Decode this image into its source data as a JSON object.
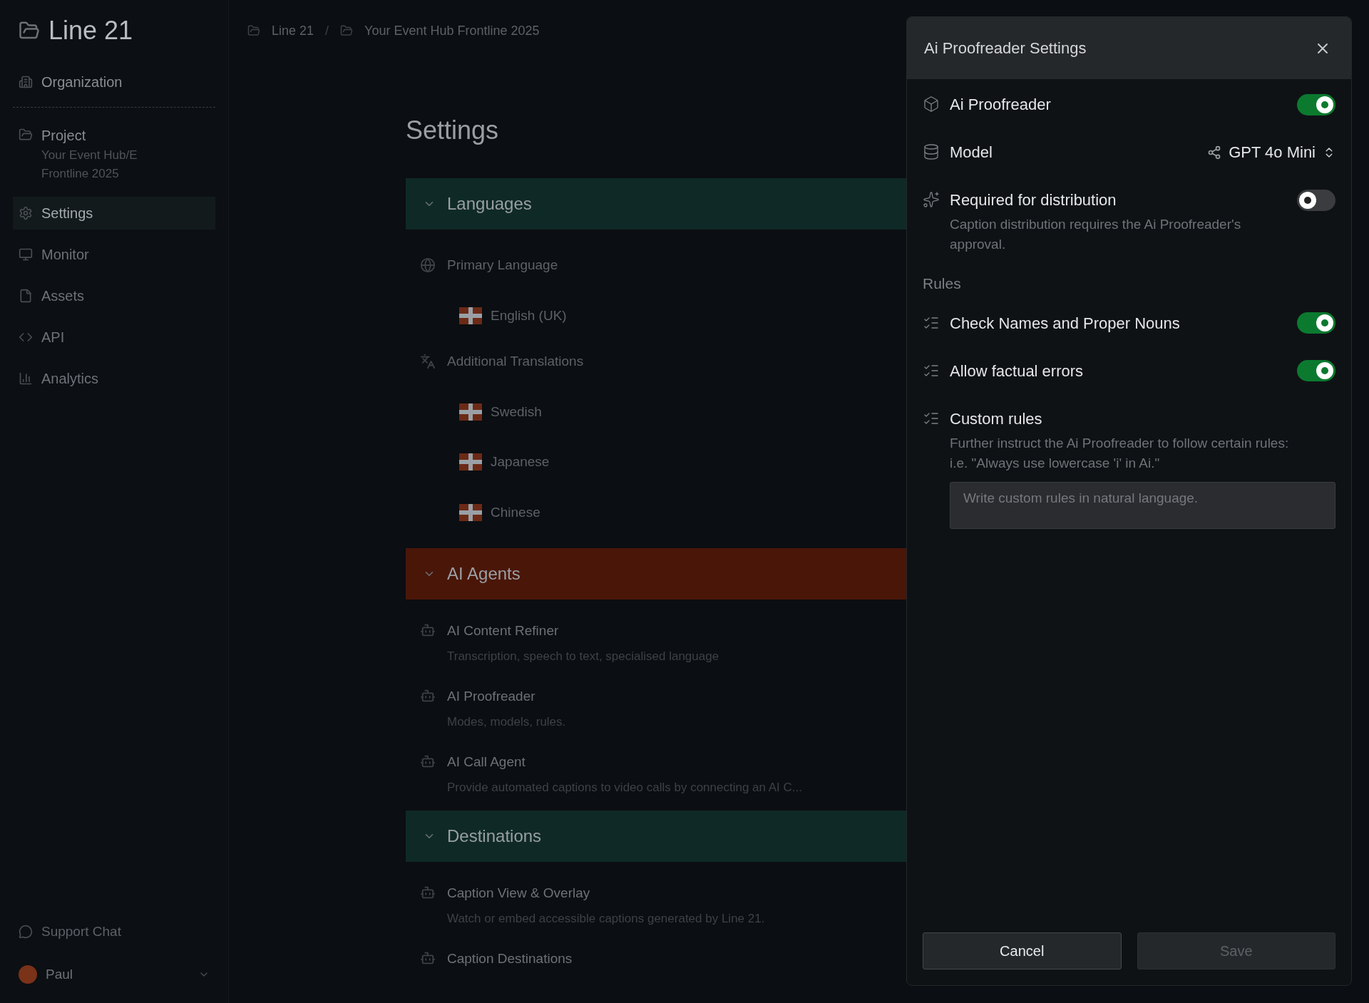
{
  "sidebar": {
    "logo": "Line 21",
    "organization": "Organization",
    "project": {
      "label": "Project",
      "name": "Your Event Hub/E",
      "subtitle": "Frontline 2025"
    },
    "items": [
      {
        "label": "Settings",
        "selected": true
      },
      {
        "label": "Monitor",
        "selected": false
      },
      {
        "label": "Assets",
        "selected": false
      },
      {
        "label": "API",
        "selected": false
      },
      {
        "label": "Analytics",
        "selected": false
      }
    ],
    "support": "Support Chat",
    "user": "Paul"
  },
  "breadcrumb": [
    "Line 21",
    "Your Event Hub Frontline 2025"
  ],
  "breadcrumb_separator": "/",
  "page_title": "Settings",
  "sections": [
    {
      "title": "Languages",
      "color": "#0f2a26",
      "groups": [
        {
          "label": "Primary Language",
          "languages": [
            "English (UK)"
          ]
        },
        {
          "label": "Additional Translations",
          "languages": [
            "Swedish",
            "Japanese",
            "Chinese"
          ]
        }
      ]
    },
    {
      "title": "AI Agents",
      "color": "#4a1608",
      "agents": [
        {
          "name": "AI Content Refiner",
          "description": "Transcription, speech to text, specialised language"
        },
        {
          "name": "AI Proofreader",
          "description": "Modes, models, rules."
        },
        {
          "name": "AI Call Agent",
          "description": "Provide automated captions to video calls by connecting an AI C..."
        }
      ]
    },
    {
      "title": "Destinations",
      "color": "#0f2a26",
      "agents": [
        {
          "name": "Caption View & Overlay",
          "description": "Watch or embed accessible captions generated by Line 21."
        },
        {
          "name": "Caption Destinations"
        }
      ]
    }
  ],
  "dialog": {
    "title": "Ai Proofreader Settings",
    "settings": [
      {
        "kind": "toggle",
        "label": "Ai Proofreader",
        "on": true
      },
      {
        "kind": "select",
        "label": "Model",
        "value": "GPT 4o Mini"
      },
      {
        "kind": "toggle",
        "label": "Required for distribution",
        "on": false,
        "description": "Caption distribution requires the Ai Proofreader's approval."
      }
    ],
    "rules_heading": "Rules",
    "rules": [
      {
        "kind": "toggle",
        "label": "Check Names and Proper Nouns",
        "on": true
      },
      {
        "kind": "toggle",
        "label": "Allow factual errors",
        "on": true
      },
      {
        "kind": "text",
        "label": "Custom rules",
        "description": "Further instruct the Ai Proofreader to follow certain rules: i.e. \"Always use lowercase 'i' in Ai.\"",
        "placeholder": "Write custom rules in natural language."
      }
    ],
    "buttons": [
      {
        "label": "Cancel",
        "disabled": false
      },
      {
        "label": "Save",
        "disabled": true
      }
    ]
  }
}
